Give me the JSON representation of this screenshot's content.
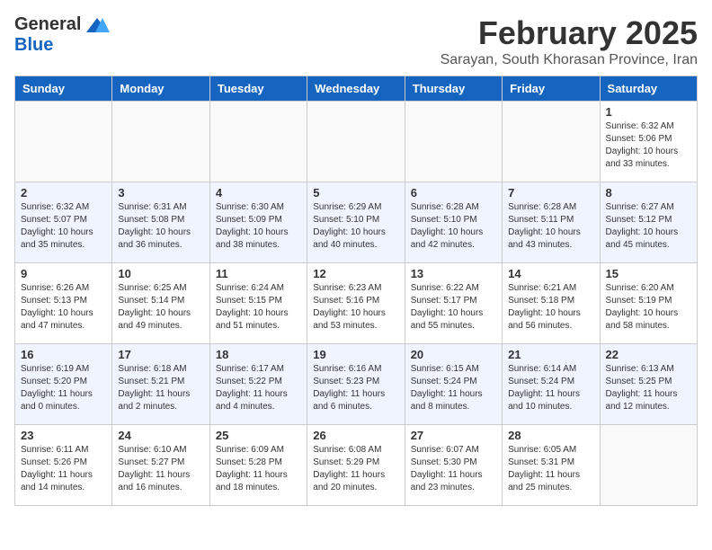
{
  "logo": {
    "general": "General",
    "blue": "Blue"
  },
  "title": "February 2025",
  "subtitle": "Sarayan, South Khorasan Province, Iran",
  "days_header": [
    "Sunday",
    "Monday",
    "Tuesday",
    "Wednesday",
    "Thursday",
    "Friday",
    "Saturday"
  ],
  "weeks": [
    [
      {
        "day": "",
        "info": ""
      },
      {
        "day": "",
        "info": ""
      },
      {
        "day": "",
        "info": ""
      },
      {
        "day": "",
        "info": ""
      },
      {
        "day": "",
        "info": ""
      },
      {
        "day": "",
        "info": ""
      },
      {
        "day": "1",
        "info": "Sunrise: 6:32 AM\nSunset: 5:06 PM\nDaylight: 10 hours\nand 33 minutes."
      }
    ],
    [
      {
        "day": "2",
        "info": "Sunrise: 6:32 AM\nSunset: 5:07 PM\nDaylight: 10 hours\nand 35 minutes."
      },
      {
        "day": "3",
        "info": "Sunrise: 6:31 AM\nSunset: 5:08 PM\nDaylight: 10 hours\nand 36 minutes."
      },
      {
        "day": "4",
        "info": "Sunrise: 6:30 AM\nSunset: 5:09 PM\nDaylight: 10 hours\nand 38 minutes."
      },
      {
        "day": "5",
        "info": "Sunrise: 6:29 AM\nSunset: 5:10 PM\nDaylight: 10 hours\nand 40 minutes."
      },
      {
        "day": "6",
        "info": "Sunrise: 6:28 AM\nSunset: 5:10 PM\nDaylight: 10 hours\nand 42 minutes."
      },
      {
        "day": "7",
        "info": "Sunrise: 6:28 AM\nSunset: 5:11 PM\nDaylight: 10 hours\nand 43 minutes."
      },
      {
        "day": "8",
        "info": "Sunrise: 6:27 AM\nSunset: 5:12 PM\nDaylight: 10 hours\nand 45 minutes."
      }
    ],
    [
      {
        "day": "9",
        "info": "Sunrise: 6:26 AM\nSunset: 5:13 PM\nDaylight: 10 hours\nand 47 minutes."
      },
      {
        "day": "10",
        "info": "Sunrise: 6:25 AM\nSunset: 5:14 PM\nDaylight: 10 hours\nand 49 minutes."
      },
      {
        "day": "11",
        "info": "Sunrise: 6:24 AM\nSunset: 5:15 PM\nDaylight: 10 hours\nand 51 minutes."
      },
      {
        "day": "12",
        "info": "Sunrise: 6:23 AM\nSunset: 5:16 PM\nDaylight: 10 hours\nand 53 minutes."
      },
      {
        "day": "13",
        "info": "Sunrise: 6:22 AM\nSunset: 5:17 PM\nDaylight: 10 hours\nand 55 minutes."
      },
      {
        "day": "14",
        "info": "Sunrise: 6:21 AM\nSunset: 5:18 PM\nDaylight: 10 hours\nand 56 minutes."
      },
      {
        "day": "15",
        "info": "Sunrise: 6:20 AM\nSunset: 5:19 PM\nDaylight: 10 hours\nand 58 minutes."
      }
    ],
    [
      {
        "day": "16",
        "info": "Sunrise: 6:19 AM\nSunset: 5:20 PM\nDaylight: 11 hours\nand 0 minutes."
      },
      {
        "day": "17",
        "info": "Sunrise: 6:18 AM\nSunset: 5:21 PM\nDaylight: 11 hours\nand 2 minutes."
      },
      {
        "day": "18",
        "info": "Sunrise: 6:17 AM\nSunset: 5:22 PM\nDaylight: 11 hours\nand 4 minutes."
      },
      {
        "day": "19",
        "info": "Sunrise: 6:16 AM\nSunset: 5:23 PM\nDaylight: 11 hours\nand 6 minutes."
      },
      {
        "day": "20",
        "info": "Sunrise: 6:15 AM\nSunset: 5:24 PM\nDaylight: 11 hours\nand 8 minutes."
      },
      {
        "day": "21",
        "info": "Sunrise: 6:14 AM\nSunset: 5:24 PM\nDaylight: 11 hours\nand 10 minutes."
      },
      {
        "day": "22",
        "info": "Sunrise: 6:13 AM\nSunset: 5:25 PM\nDaylight: 11 hours\nand 12 minutes."
      }
    ],
    [
      {
        "day": "23",
        "info": "Sunrise: 6:11 AM\nSunset: 5:26 PM\nDaylight: 11 hours\nand 14 minutes."
      },
      {
        "day": "24",
        "info": "Sunrise: 6:10 AM\nSunset: 5:27 PM\nDaylight: 11 hours\nand 16 minutes."
      },
      {
        "day": "25",
        "info": "Sunrise: 6:09 AM\nSunset: 5:28 PM\nDaylight: 11 hours\nand 18 minutes."
      },
      {
        "day": "26",
        "info": "Sunrise: 6:08 AM\nSunset: 5:29 PM\nDaylight: 11 hours\nand 20 minutes."
      },
      {
        "day": "27",
        "info": "Sunrise: 6:07 AM\nSunset: 5:30 PM\nDaylight: 11 hours\nand 23 minutes."
      },
      {
        "day": "28",
        "info": "Sunrise: 6:05 AM\nSunset: 5:31 PM\nDaylight: 11 hours\nand 25 minutes."
      },
      {
        "day": "",
        "info": ""
      }
    ]
  ]
}
